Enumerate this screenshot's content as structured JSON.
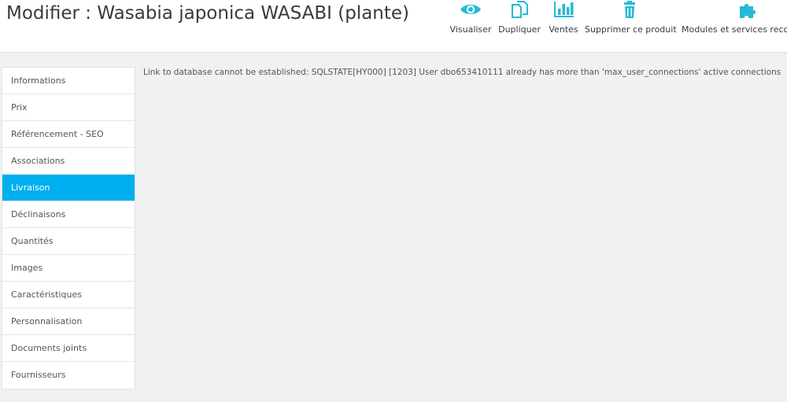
{
  "header": {
    "title": "Modifier : Wasabia japonica WASABI (plante)",
    "toolbar": [
      {
        "label": "Visualiser",
        "icon": "eye-icon"
      },
      {
        "label": "Dupliquer",
        "icon": "copy-icon"
      },
      {
        "label": "Ventes",
        "icon": "bar-chart-icon"
      },
      {
        "label": "Supprimer ce produit",
        "icon": "trash-icon"
      },
      {
        "label": "Modules et services recom",
        "icon": "puzzle-icon"
      }
    ]
  },
  "accent_color": "#00aff0",
  "sidebar": {
    "tabs": [
      {
        "label": "Informations"
      },
      {
        "label": "Prix"
      },
      {
        "label": "Référencement - SEO"
      },
      {
        "label": "Associations"
      },
      {
        "label": "Livraison"
      },
      {
        "label": "Déclinaisons"
      },
      {
        "label": "Quantités"
      },
      {
        "label": "Images"
      },
      {
        "label": "Caractéristiques"
      },
      {
        "label": "Personnalisation"
      },
      {
        "label": "Documents joints"
      },
      {
        "label": "Fournisseurs"
      }
    ],
    "active_tab": "Livraison"
  },
  "main": {
    "message": "Link to database cannot be established: SQLSTATE[HY000] [1203] User dbo653410111 already has more than 'max_user_connections' active connections"
  }
}
